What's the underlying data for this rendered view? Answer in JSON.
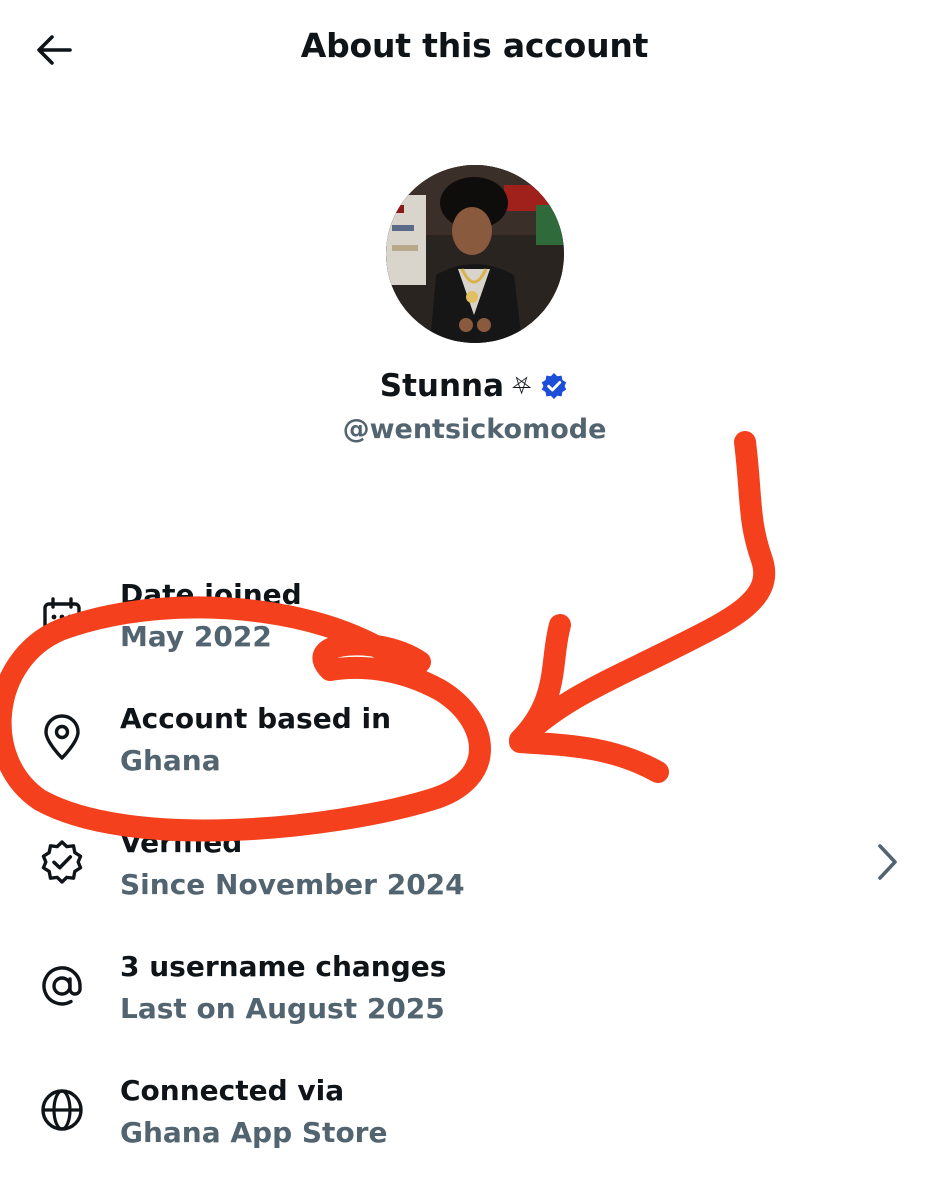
{
  "header": {
    "title": "About this account",
    "back_icon": "arrow-left-icon"
  },
  "profile": {
    "display_name": "Stunna",
    "name_emoji": "⛧",
    "verified_icon": "verified-badge-icon",
    "verified_color": "#1d4ed8",
    "handle": "@wentsickomode"
  },
  "rows": [
    {
      "icon": "calendar-icon",
      "label": "Date joined",
      "value": "May 2022"
    },
    {
      "icon": "location-pin-icon",
      "label": "Account based in",
      "value": "Ghana"
    },
    {
      "icon": "verified-outline-icon",
      "label": "Verified",
      "value": "Since November 2024",
      "chevron_icon": "chevron-right-icon"
    },
    {
      "icon": "at-sign-icon",
      "label": "3 username changes",
      "value": "Last on August 2025"
    },
    {
      "icon": "globe-icon",
      "label": "Connected via",
      "value": "Ghana App Store"
    }
  ],
  "colors": {
    "primary_text": "#0f1419",
    "secondary_text": "#536471",
    "annotation_red": "#f4401c"
  }
}
